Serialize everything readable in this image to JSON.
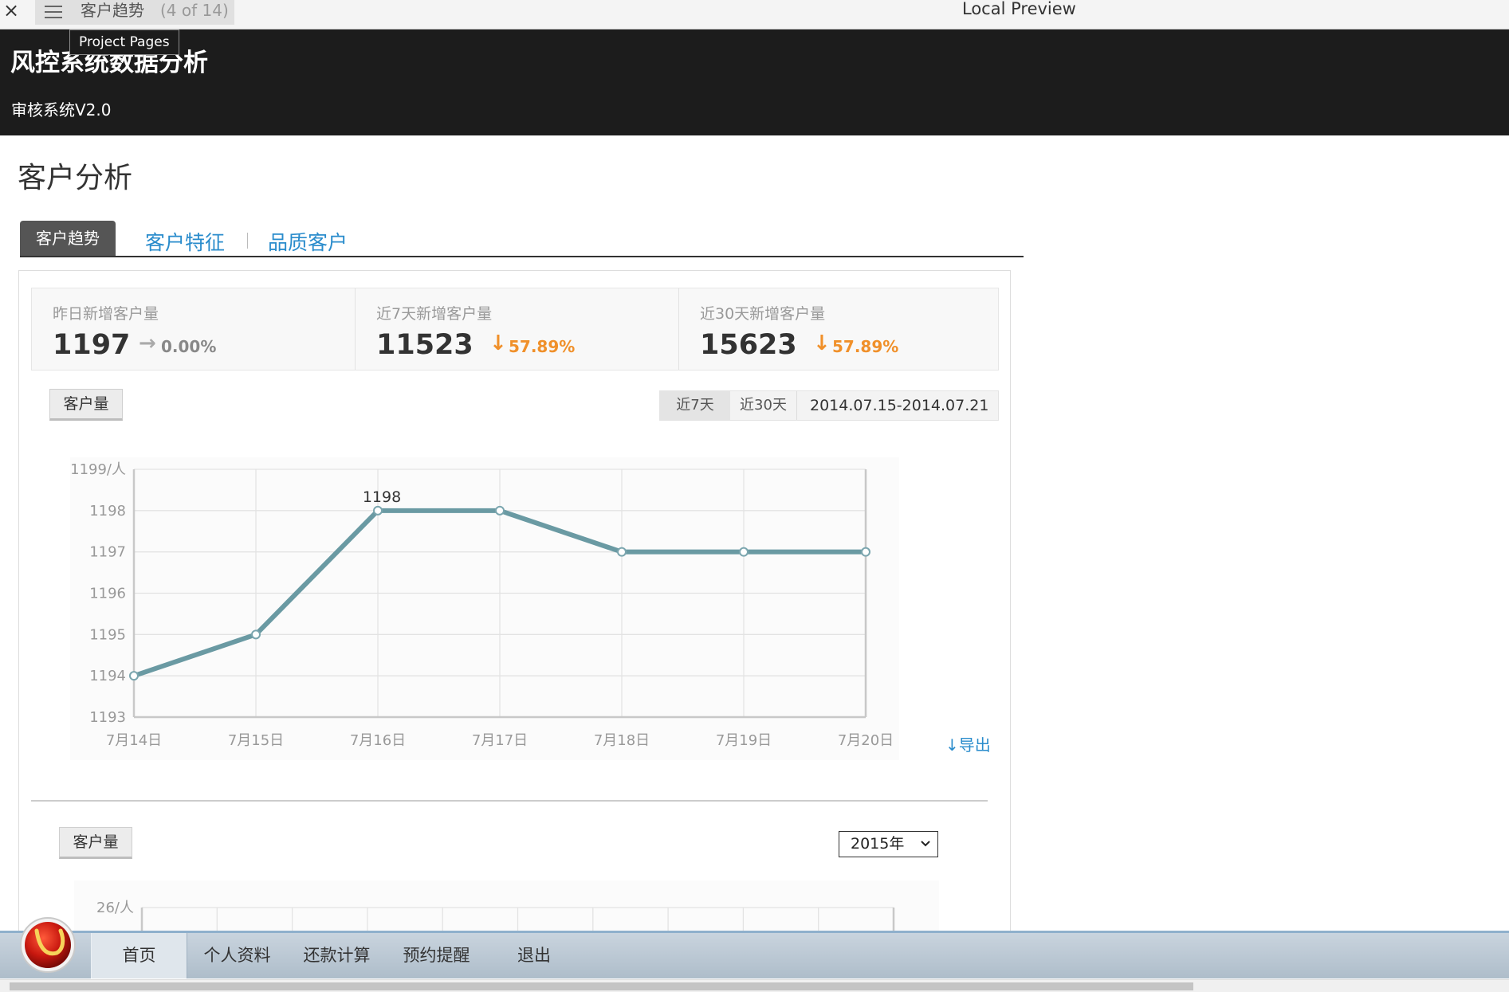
{
  "preview_bar": {
    "close_symbol": "×",
    "page_title": "客户趋势",
    "page_count": "(4 of 14)",
    "window_title": "Local Preview",
    "tooltip": "Project Pages"
  },
  "header": {
    "title": "风控系统数据分析",
    "subtitle": "审核系统V2.0"
  },
  "page": {
    "title": "客户分析"
  },
  "tabs": [
    {
      "label": "客户趋势",
      "active": true
    },
    {
      "label": "客户特征",
      "active": false
    },
    {
      "label": "品质客户",
      "active": false
    }
  ],
  "stats": [
    {
      "label": "昨日新增客户量",
      "value": "1197",
      "change": "0.00%",
      "direction": "flat",
      "color": "#888888"
    },
    {
      "label": "近7天新增客户量",
      "value": "11523",
      "change": "57.89%",
      "direction": "down",
      "color": "#f0902a"
    },
    {
      "label": "近30天新增客户量",
      "value": "15623",
      "change": "57.89%",
      "direction": "down",
      "color": "#f0902a"
    }
  ],
  "chart1_controls": {
    "metric_button": "客户量",
    "range_7": "近7天",
    "range_30": "近30天",
    "date_range": "2014.07.15-2014.07.21",
    "export": "↓导出"
  },
  "chart2_controls": {
    "metric_button": "客户量",
    "year_select": "2015年"
  },
  "chart_data": [
    {
      "type": "line",
      "categories": [
        "7月14日",
        "7月15日",
        "7月16日",
        "7月17日",
        "7月18日",
        "7月19日",
        "7月20日"
      ],
      "values": [
        1194,
        1195,
        1198,
        1198,
        1197,
        1197,
        1197
      ],
      "y_ticks": [
        "1199/人",
        "1198",
        "1197",
        "1196",
        "1195",
        "1194",
        "1193"
      ],
      "ylim": [
        1193,
        1199
      ],
      "annotation": {
        "index": 2,
        "text": "1198"
      },
      "grid": true,
      "line_color": "#6a9aa3"
    },
    {
      "type": "line",
      "y_ticks": [
        "26/人"
      ],
      "grid": true
    }
  ],
  "bottom_nav": {
    "items": [
      "首页",
      "个人资料",
      "还款计算",
      "预约提醒",
      "退出"
    ]
  }
}
